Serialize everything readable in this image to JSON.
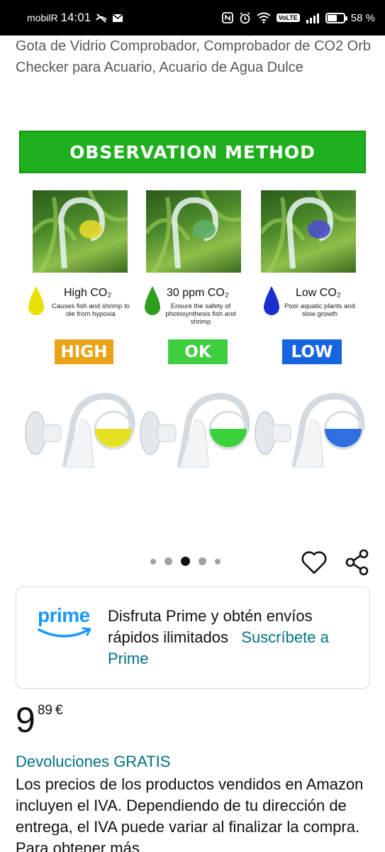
{
  "status_bar": {
    "carrier": "mobilR",
    "time": "14:01",
    "battery": "58 %",
    "volte": "VoLTE",
    "icons": [
      "no-calls-icon",
      "mail-icon",
      "nfc-icon",
      "alarm-icon",
      "wifi-icon",
      "volte-icon",
      "signal-icon",
      "battery-icon"
    ]
  },
  "product": {
    "title": "Gota de Vidrio Comprobador, Comprobador de CO2 Orb Checker para Acuario, Acuario de Agua Dulce"
  },
  "image": {
    "banner": "OBSERVATION METHOD",
    "columns": [
      {
        "title": "High CO₂",
        "desc": "Causes fish and shrimp to die from hypoxia",
        "badge": "HIGH",
        "badge_color": "#e8a317",
        "liquid_color": "#e6e024",
        "drop_color": "#e8e000"
      },
      {
        "title": "30 ppm CO₂",
        "desc": "Ensure the safety of photosynthesis fish and shrimp",
        "badge": "OK",
        "badge_color": "#3ecf3e",
        "liquid_color": "#3dd13d",
        "drop_color": "#2e9e1f"
      },
      {
        "title": "Low CO₂",
        "desc": "Poor aquatic plants and slow growth",
        "badge": "LOW",
        "badge_color": "#1565e0",
        "liquid_color": "#2f6fe0",
        "drop_color": "#1a2fd0"
      }
    ]
  },
  "carousel": {
    "total_dots": 5,
    "active_index": 2
  },
  "actions": {
    "favorite_icon": "heart-icon",
    "share_icon": "share-icon"
  },
  "prime": {
    "logo_word": "prime",
    "message": "Disfruta Prime y obtén envíos rápidos ilimitados",
    "link": "Suscríbete a Prime",
    "brand_color": "#1a98ff"
  },
  "price": {
    "whole": "9",
    "fraction": "89",
    "currency": "€"
  },
  "returns": "Devoluciones GRATIS",
  "vat_text": "Los precios de los productos vendidos en Amazon incluyen el IVA. Dependiendo de tu dirección de entrega, el IVA puede variar al finalizar la compra. Para obtener más"
}
